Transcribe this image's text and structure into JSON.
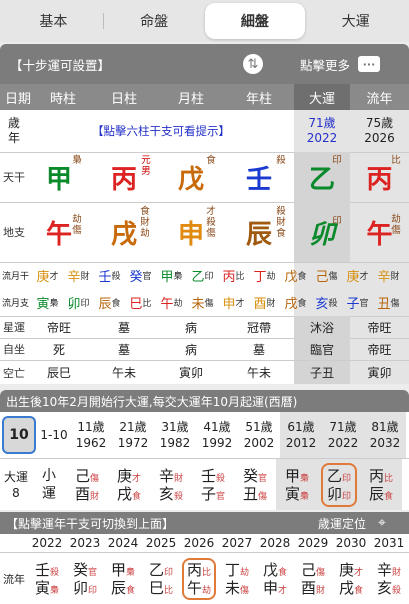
{
  "tabs": [
    "基本",
    "命盤",
    "細盤",
    "大運"
  ],
  "active_tab": 2,
  "header1": {
    "title": "【十步運可設置】",
    "more": "點擊更多"
  },
  "cols": {
    "label": "日期",
    "items": [
      "時柱",
      "日柱",
      "月柱",
      "年柱",
      "大運",
      "流年"
    ]
  },
  "age_row": {
    "label": "歲年",
    "hint": "【點擊六柱干支可看提示】",
    "dayun_age": "71歲",
    "dayun_year": "2022",
    "liunian_age": "75歲",
    "liunian_year": "2026"
  },
  "tiangan": {
    "label": "天干",
    "chars": [
      "甲",
      "丙",
      "戊",
      "壬",
      "乙",
      "丙"
    ],
    "tags": [
      "梟",
      "元男",
      "食",
      "殺",
      "印",
      "比"
    ]
  },
  "dizhi": {
    "label": "地支",
    "chars": [
      "午",
      "戌",
      "申",
      "辰",
      "卯",
      "午"
    ],
    "tags": [
      "劫傷",
      "食財劫",
      "才殺傷",
      "殺財食",
      "印",
      "劫傷"
    ]
  },
  "liuyue": {
    "label": "流月干",
    "cells": [
      [
        "庚",
        "才"
      ],
      [
        "辛",
        "財"
      ],
      [
        "壬",
        "殺"
      ],
      [
        "癸",
        "官"
      ],
      [
        "甲",
        "梟"
      ],
      [
        "乙",
        "印"
      ],
      [
        "丙",
        "比"
      ],
      [
        "丁",
        "劫"
      ],
      [
        "戊",
        "食"
      ],
      [
        "己",
        "傷"
      ],
      [
        "庚",
        "才"
      ],
      [
        "辛",
        "財"
      ]
    ]
  },
  "liuyuez": {
    "label": "流月支",
    "cells": [
      [
        "寅",
        "梟"
      ],
      [
        "卯",
        "印"
      ],
      [
        "辰",
        "食"
      ],
      [
        "巳",
        "比"
      ],
      [
        "午",
        "劫"
      ],
      [
        "未",
        "傷"
      ],
      [
        "申",
        "才"
      ],
      [
        "酉",
        "財"
      ],
      [
        "戌",
        "食"
      ],
      [
        "亥",
        "殺"
      ],
      [
        "子",
        "官"
      ],
      [
        "丑",
        "傷"
      ]
    ]
  },
  "xingyun": {
    "label": "星運",
    "items": [
      "帝旺",
      "墓",
      "病",
      "冠帶",
      "沐浴",
      "帝旺"
    ]
  },
  "zizuo": {
    "label": "自坐",
    "items": [
      "死",
      "墓",
      "病",
      "墓",
      "臨官",
      "帝旺"
    ]
  },
  "kongwang": {
    "label": "空亡",
    "items": [
      "辰巳",
      "午未",
      "寅卯",
      "午未",
      "子丑",
      "寅卯"
    ]
  },
  "header2": {
    "title": "出生後10年2月開始行大運,每交大運年10月起運(西曆)"
  },
  "dayun": {
    "first": "10",
    "range": "1-10",
    "items": [
      [
        "11歲",
        "1962"
      ],
      [
        "21歲",
        "1972"
      ],
      [
        "31歲",
        "1982"
      ],
      [
        "41歲",
        "1992"
      ],
      [
        "51歲",
        "2002"
      ],
      [
        "61歲",
        "2012"
      ],
      [
        "71歲",
        "2022"
      ],
      [
        "81歲",
        "2032"
      ]
    ]
  },
  "dayun_gz": {
    "label1": "大運",
    "label2": "8",
    "small": [
      "小",
      "運"
    ],
    "items": [
      [
        "己",
        "傷",
        "酉",
        "財"
      ],
      [
        "庚",
        "才",
        "戌",
        "食"
      ],
      [
        "辛",
        "財",
        "亥",
        "殺"
      ],
      [
        "壬",
        "殺",
        "子",
        "官"
      ],
      [
        "癸",
        "官",
        "丑",
        "傷"
      ],
      [
        "甲",
        "梟",
        "寅",
        "梟"
      ],
      [
        "乙",
        "印",
        "卯",
        "印"
      ],
      [
        "丙",
        "比",
        "辰",
        "食"
      ]
    ]
  },
  "header3": {
    "title": "【點擊運年干支可切換到上面】",
    "locate": "歲運定位"
  },
  "years": [
    "2022",
    "2023",
    "2024",
    "2025",
    "2026",
    "2027",
    "2028",
    "2029",
    "2030",
    "2031"
  ],
  "liunian": {
    "label": "流年",
    "items": [
      [
        "壬",
        "殺",
        "寅",
        "梟"
      ],
      [
        "癸",
        "官",
        "卯",
        "印"
      ],
      [
        "甲",
        "梟",
        "辰",
        "食"
      ],
      [
        "乙",
        "印",
        "巳",
        "比"
      ],
      [
        "丙",
        "比",
        "午",
        "劫"
      ],
      [
        "丁",
        "劫",
        "未",
        "傷"
      ],
      [
        "戊",
        "食",
        "申",
        "才"
      ],
      [
        "己",
        "傷",
        "酉",
        "財"
      ],
      [
        "庚",
        "才",
        "戌",
        "食"
      ],
      [
        "辛",
        "財",
        "亥",
        "殺"
      ]
    ]
  }
}
